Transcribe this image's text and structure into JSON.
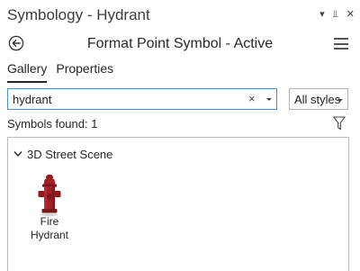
{
  "window": {
    "title": "Symbology - Hydrant",
    "controls": {
      "dropdown": "▾",
      "pin": "⫫",
      "close": "✕"
    }
  },
  "header": {
    "title": "Format Point Symbol - Active"
  },
  "tabs": [
    {
      "label": "Gallery",
      "active": true
    },
    {
      "label": "Properties",
      "active": false
    }
  ],
  "search": {
    "value": "hydrant",
    "clear_glyph": "×"
  },
  "style_filter": {
    "selected": "All styles"
  },
  "results": {
    "found_text": "Symbols found: 1"
  },
  "gallery": {
    "groups": [
      {
        "label": "3D Street Scene",
        "symbols": [
          {
            "label_line1": "Fire",
            "label_line2": "Hydrant"
          }
        ]
      }
    ]
  },
  "colors": {
    "accent": "#4a90d9",
    "hydrant": "#a31f24",
    "hydrant_dark": "#6e1417"
  },
  "icons": [
    "back-arrow-icon",
    "menu-icon",
    "chevron-down-icon",
    "filter-icon",
    "pin-icon",
    "close-icon",
    "fire-hydrant-icon"
  ]
}
